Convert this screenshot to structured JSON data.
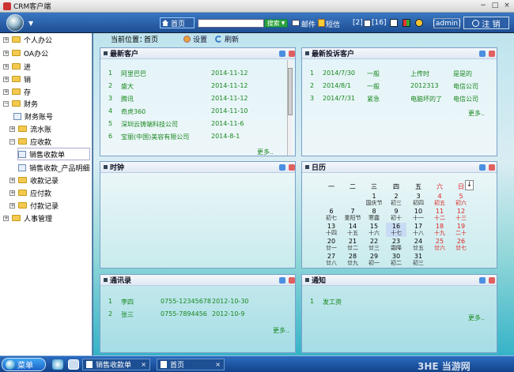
{
  "window": {
    "title": "CRM客户端",
    "minimize": "−",
    "maximize": "□",
    "close": "×"
  },
  "toolbar": {
    "home": "首页",
    "search_value": "",
    "search_select": "搜索",
    "mail": "邮件",
    "sms": "短信",
    "counter_a": "[2]",
    "counter_b": "[16]",
    "user": "[admin]",
    "logout": "注 销"
  },
  "sidebar": {
    "items": [
      {
        "label": "个人办公",
        "toggle": "+",
        "icon": "folder-icon"
      },
      {
        "label": "OA办公",
        "toggle": "+",
        "icon": "folder-icon"
      },
      {
        "label": "进",
        "toggle": "+",
        "icon": "folder-icon"
      },
      {
        "label": "销",
        "toggle": "+",
        "icon": "folder-icon"
      },
      {
        "label": "存",
        "toggle": "+",
        "icon": "folder-icon"
      },
      {
        "label": "财务",
        "toggle": "−",
        "icon": "folder-icon"
      },
      {
        "label": "财务账号",
        "toggle": "",
        "icon": "document-icon"
      },
      {
        "label": "流水账",
        "toggle": "+",
        "icon": "folder-icon"
      },
      {
        "label": "应收款",
        "toggle": "−",
        "icon": "folder-icon"
      },
      {
        "label": "销售收款单",
        "toggle": "",
        "icon": "document-icon",
        "selected": true
      },
      {
        "label": "销售收款_产品明细",
        "toggle": "",
        "icon": "document-icon"
      },
      {
        "label": "收款记录",
        "toggle": "+",
        "icon": "folder-icon"
      },
      {
        "label": "应付款",
        "toggle": "+",
        "icon": "folder-icon"
      },
      {
        "label": "付款记录",
        "toggle": "+",
        "icon": "folder-icon"
      },
      {
        "label": "人事管理",
        "toggle": "+",
        "icon": "folder-icon"
      }
    ]
  },
  "breadcrumb": {
    "label": "当前位置：",
    "value": "首页",
    "settings": "设置",
    "refresh": "刷新"
  },
  "panels": {
    "customers": {
      "title": "最新客户",
      "rows": [
        {
          "no": "1",
          "name": "阿里巴巴",
          "date": "2014-11-12"
        },
        {
          "no": "2",
          "name": "盛大",
          "date": "2014-11-12"
        },
        {
          "no": "3",
          "name": "腾讯",
          "date": "2014-11-12"
        },
        {
          "no": "4",
          "name": "奇虎360",
          "date": "2014-11-10"
        },
        {
          "no": "5",
          "name": "深圳云铸端科技公司",
          "date": "2014-11-6"
        },
        {
          "no": "6",
          "name": "宝丽(中国)美容有限公司",
          "date": "2014-8-1"
        }
      ],
      "more": "更多.."
    },
    "complaints": {
      "title": "最新投诉客户",
      "rows": [
        {
          "no": "1",
          "date": "2014/7/30",
          "level": "一般",
          "subject": "上传时",
          "customer": "是是的"
        },
        {
          "no": "2",
          "date": "2014/8/1",
          "level": "一般",
          "subject": "2012313",
          "customer": "电信公司"
        },
        {
          "no": "3",
          "date": "2014/7/31",
          "level": "紧急",
          "subject": "电脑坏的了",
          "customer": "电信公司"
        }
      ],
      "more": "更多.."
    },
    "clock": {
      "title": "时钟"
    },
    "calendar": {
      "title": "日历",
      "weekdays": [
        "一",
        "二",
        "三",
        "四",
        "五",
        "六",
        "日"
      ],
      "nav": "↓",
      "days": [
        {
          "n": "1",
          "l": "国庆节"
        },
        {
          "n": "2",
          "l": "初三"
        },
        {
          "n": "3",
          "l": "初四"
        },
        {
          "n": "4",
          "l": "初五"
        },
        {
          "n": "5",
          "l": "初六"
        },
        {
          "n": "6",
          "l": "初七"
        },
        {
          "n": "7",
          "l": "重阳节"
        },
        {
          "n": "8",
          "l": "寒露"
        },
        {
          "n": "9",
          "l": "初十"
        },
        {
          "n": "10",
          "l": "十一"
        },
        {
          "n": "11",
          "l": "十二"
        },
        {
          "n": "12",
          "l": "十三"
        },
        {
          "n": "13",
          "l": "十四"
        },
        {
          "n": "14",
          "l": "十五"
        },
        {
          "n": "15",
          "l": "十六"
        },
        {
          "n": "16",
          "l": "十七"
        },
        {
          "n": "17",
          "l": "十八"
        },
        {
          "n": "18",
          "l": "十九"
        },
        {
          "n": "19",
          "l": "二十"
        },
        {
          "n": "20",
          "l": "廿一"
        },
        {
          "n": "21",
          "l": "廿二"
        },
        {
          "n": "22",
          "l": "廿三"
        },
        {
          "n": "23",
          "l": "霜降"
        },
        {
          "n": "24",
          "l": "廿五"
        },
        {
          "n": "25",
          "l": "廿六"
        },
        {
          "n": "26",
          "l": "廿七"
        },
        {
          "n": "27",
          "l": "廿八"
        },
        {
          "n": "28",
          "l": "廿九"
        },
        {
          "n": "29",
          "l": "初一"
        },
        {
          "n": "30",
          "l": "初二"
        },
        {
          "n": "31",
          "l": "初三"
        }
      ]
    },
    "contacts": {
      "title": "通讯录",
      "rows": [
        {
          "no": "1",
          "name": "李四",
          "phone": "0755-12345678",
          "date": "2012-10-30"
        },
        {
          "no": "2",
          "name": "张三",
          "phone": "0755-7894456",
          "date": "2012-10-9"
        }
      ],
      "more": "更多.."
    },
    "notices": {
      "title": "通知",
      "rows": [
        {
          "no": "1",
          "text": "发工资"
        }
      ],
      "more": "更多.."
    }
  },
  "taskbar": {
    "start": "菜单",
    "tasks": [
      {
        "label": "销售收款单",
        "close": "×"
      },
      {
        "label": "首页",
        "close": "×"
      }
    ]
  },
  "watermark": "3HE 当游网",
  "colors": {
    "accent": "#1d4f93",
    "link_green": "#18871e",
    "holiday_red": "#d22222"
  }
}
